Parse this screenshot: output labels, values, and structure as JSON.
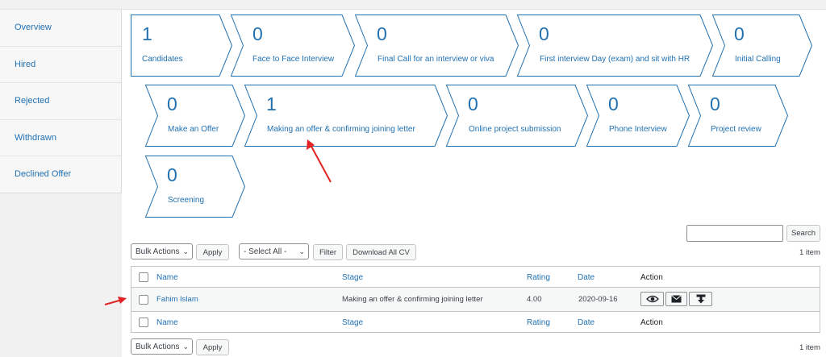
{
  "sidebar": {
    "items": [
      {
        "label": "Overview"
      },
      {
        "label": "Hired"
      },
      {
        "label": "Rejected"
      },
      {
        "label": "Withdrawn"
      },
      {
        "label": "Declined Offer"
      }
    ]
  },
  "stages": [
    {
      "count": "1",
      "label": "Candidates"
    },
    {
      "count": "0",
      "label": "Face to Face Interview"
    },
    {
      "count": "0",
      "label": "Final Call for an interview or viva"
    },
    {
      "count": "0",
      "label": "First interview Day (exam) and sit with HR"
    },
    {
      "count": "0",
      "label": "Initial Calling"
    },
    {
      "count": "0",
      "label": "Make an Offer"
    },
    {
      "count": "1",
      "label": "Making an offer & confirming joining letter"
    },
    {
      "count": "0",
      "label": "Online project submission"
    },
    {
      "count": "0",
      "label": "Phone Interview"
    },
    {
      "count": "0",
      "label": "Project review"
    },
    {
      "count": "0",
      "label": "Screening"
    }
  ],
  "search": {
    "button": "Search",
    "value": ""
  },
  "toolbar_top": {
    "bulk_actions": "Bulk Actions",
    "apply": "Apply",
    "select_all": "- Select All -",
    "filter": "Filter",
    "download_all_cv": "Download All CV",
    "items_count": "1 item"
  },
  "table": {
    "headers": {
      "name": "Name",
      "stage": "Stage",
      "rating": "Rating",
      "date": "Date",
      "action": "Action"
    },
    "rows": [
      {
        "name": "Fahim Islam",
        "stage": "Making an offer & confirming joining letter",
        "rating": "4.00",
        "date": "2020-09-16"
      }
    ],
    "action_icons": [
      "eye-icon",
      "envelope-icon",
      "download-icon"
    ]
  },
  "toolbar_bottom": {
    "bulk_actions": "Bulk Actions",
    "apply": "Apply",
    "items_count": "1 item"
  },
  "colors": {
    "link": "#2271b1",
    "annotation_arrow": "#e02424",
    "border": "#c3c4c7"
  }
}
